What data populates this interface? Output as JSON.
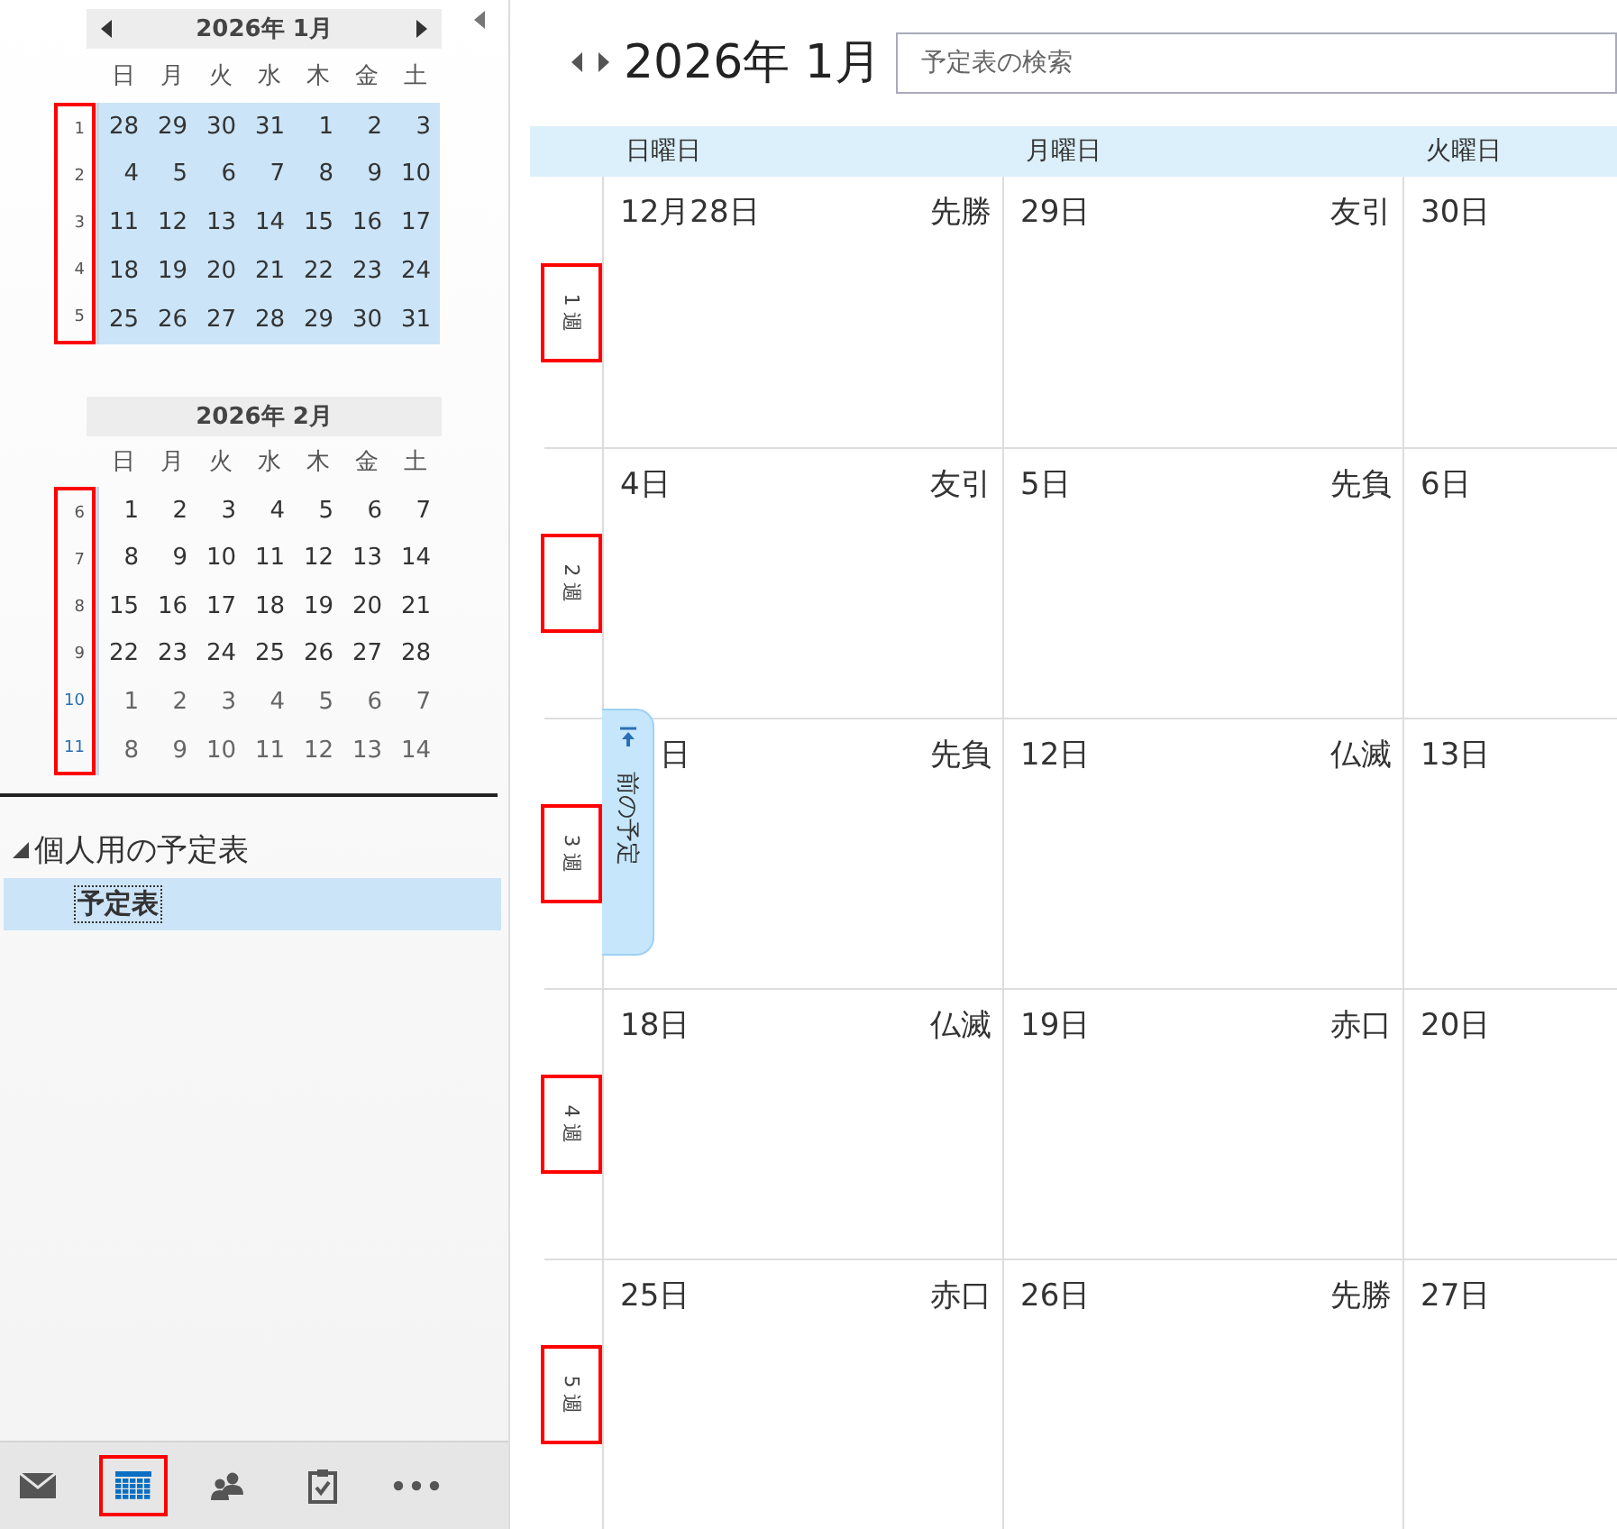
{
  "sidebar": {
    "mini_calendars": [
      {
        "title": "2026年 1月",
        "nav_arrows": true,
        "weekdays": [
          "日",
          "月",
          "火",
          "水",
          "木",
          "金",
          "土"
        ],
        "selected": true,
        "week_numbers_highlighted": true,
        "weeks": [
          {
            "number": "1",
            "dim": false,
            "days": [
              "28",
              "29",
              "30",
              "31",
              "1",
              "2",
              "3"
            ]
          },
          {
            "number": "2",
            "dim": false,
            "days": [
              "4",
              "5",
              "6",
              "7",
              "8",
              "9",
              "10"
            ]
          },
          {
            "number": "3",
            "dim": false,
            "days": [
              "11",
              "12",
              "13",
              "14",
              "15",
              "16",
              "17"
            ]
          },
          {
            "number": "4",
            "dim": false,
            "days": [
              "18",
              "19",
              "20",
              "21",
              "22",
              "23",
              "24"
            ]
          },
          {
            "number": "5",
            "dim": false,
            "days": [
              "25",
              "26",
              "27",
              "28",
              "29",
              "30",
              "31"
            ]
          }
        ]
      },
      {
        "title": "2026年 2月",
        "nav_arrows": false,
        "weekdays": [
          "日",
          "月",
          "火",
          "水",
          "木",
          "金",
          "土"
        ],
        "selected": false,
        "week_numbers_highlighted": true,
        "weeks": [
          {
            "number": "6",
            "dim": false,
            "days": [
              "1",
              "2",
              "3",
              "4",
              "5",
              "6",
              "7"
            ]
          },
          {
            "number": "7",
            "dim": false,
            "days": [
              "8",
              "9",
              "10",
              "11",
              "12",
              "13",
              "14"
            ]
          },
          {
            "number": "8",
            "dim": false,
            "days": [
              "15",
              "16",
              "17",
              "18",
              "19",
              "20",
              "21"
            ]
          },
          {
            "number": "9",
            "dim": false,
            "days": [
              "22",
              "23",
              "24",
              "25",
              "26",
              "27",
              "28"
            ]
          },
          {
            "number": "10",
            "dim": true,
            "days": [
              "1",
              "2",
              "3",
              "4",
              "5",
              "6",
              "7"
            ]
          },
          {
            "number": "11",
            "dim": true,
            "days": [
              "8",
              "9",
              "10",
              "11",
              "12",
              "13",
              "14"
            ]
          }
        ]
      }
    ],
    "calendar_groups": [
      {
        "name": "個人用の予定表",
        "expanded": true,
        "items": [
          {
            "label": "予定表",
            "selected": true
          }
        ]
      }
    ],
    "nav_items": [
      {
        "kind": "mail",
        "selected": false,
        "highlighted": false
      },
      {
        "kind": "calendar",
        "selected": true,
        "highlighted": true
      },
      {
        "kind": "people",
        "selected": false,
        "highlighted": false
      },
      {
        "kind": "tasks",
        "selected": false,
        "highlighted": false
      },
      {
        "kind": "more",
        "selected": false,
        "highlighted": false
      }
    ]
  },
  "main": {
    "title": "2026年 1月",
    "search": {
      "placeholder": "予定表の検索"
    },
    "day_headers": [
      "日曜日",
      "月曜日",
      "火曜日"
    ],
    "previous_appointment_tab": {
      "label": "前の予定"
    },
    "weeks": [
      {
        "label": "1 週",
        "highlighted": true,
        "days": [
          {
            "date": "12月28日",
            "rokuyo": "先勝"
          },
          {
            "date": "29日",
            "rokuyo": "友引"
          },
          {
            "date": "30日"
          }
        ]
      },
      {
        "label": "2 週",
        "highlighted": true,
        "days": [
          {
            "date": "4日",
            "rokuyo": "友引"
          },
          {
            "date": "5日",
            "rokuyo": "先負"
          },
          {
            "date": "6日"
          }
        ]
      },
      {
        "label": "3 週",
        "highlighted": true,
        "days": [
          {
            "date": "日",
            "rokuyo": "先負",
            "partly_covered": true
          },
          {
            "date": "12日",
            "rokuyo": "仏滅"
          },
          {
            "date": "13日"
          }
        ]
      },
      {
        "label": "4 週",
        "highlighted": true,
        "days": [
          {
            "date": "18日",
            "rokuyo": "仏滅"
          },
          {
            "date": "19日",
            "rokuyo": "赤口"
          },
          {
            "date": "20日"
          }
        ]
      },
      {
        "label": "5 週",
        "highlighted": true,
        "days": [
          {
            "date": "25日",
            "rokuyo": "赤口"
          },
          {
            "date": "26日",
            "rokuyo": "先勝"
          },
          {
            "date": "27日"
          }
        ]
      }
    ]
  }
}
